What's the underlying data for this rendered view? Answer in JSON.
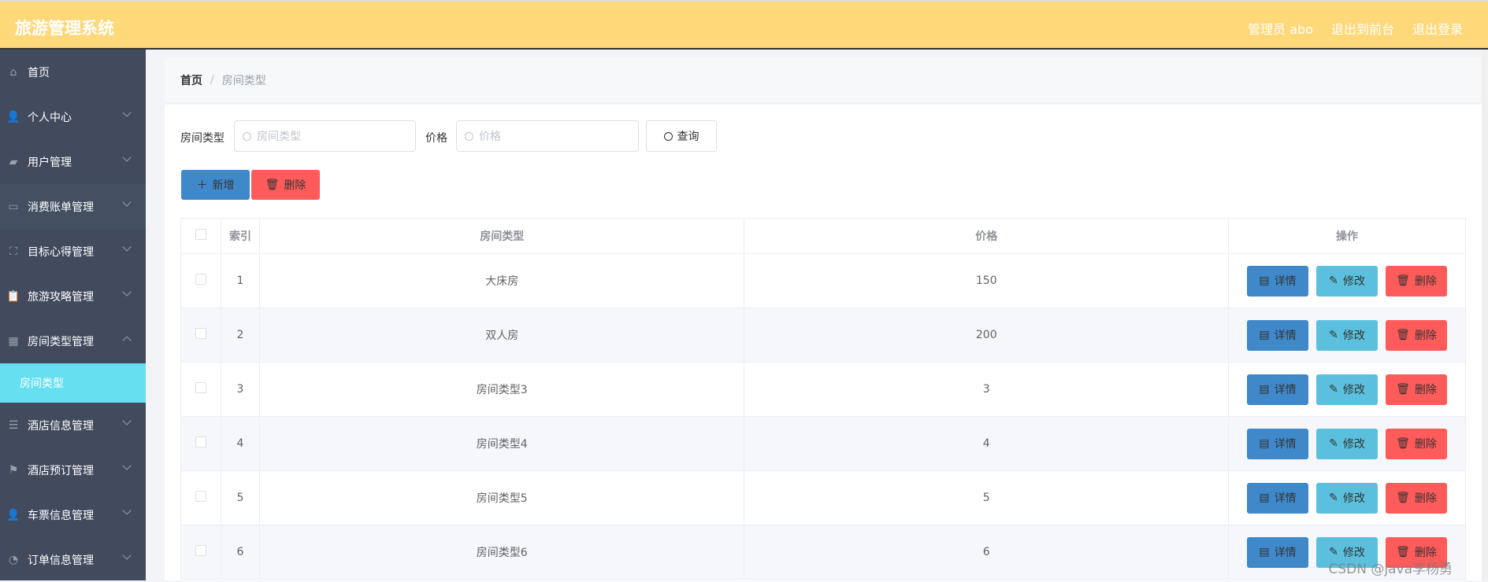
{
  "header": {
    "title": "旅游管理系统",
    "user": "管理员 abo",
    "to_front": "退出到前台",
    "logout": "退出登录"
  },
  "sidebar": {
    "items": [
      {
        "label": "首页",
        "icon": "home-icon"
      },
      {
        "label": "个人中心",
        "icon": "user-icon"
      },
      {
        "label": "用户管理",
        "icon": "wallet-icon"
      },
      {
        "label": "消费账单管理",
        "icon": "card-icon"
      },
      {
        "label": "目标心得管理",
        "icon": "frame-icon"
      },
      {
        "label": "旅游攻略管理",
        "icon": "clipboard-icon"
      },
      {
        "label": "房间类型管理",
        "icon": "grid-icon"
      },
      {
        "label": "酒店信息管理",
        "icon": "sliders-icon"
      },
      {
        "label": "酒店预订管理",
        "icon": "flag-icon"
      },
      {
        "label": "车票信息管理",
        "icon": "user-icon"
      },
      {
        "label": "订单信息管理",
        "icon": "gauge-icon"
      }
    ],
    "sub_active": "房间类型"
  },
  "breadcrumb": {
    "home": "首页",
    "current": "房间类型"
  },
  "search": {
    "type_label": "房间类型",
    "type_placeholder": "房间类型",
    "price_label": "价格",
    "price_placeholder": "价格",
    "query": "查询"
  },
  "toolbar": {
    "add": "新增",
    "delete": "删除"
  },
  "table": {
    "headers": [
      "索引",
      "房间类型",
      "价格",
      "操作"
    ],
    "rows": [
      {
        "index": "1",
        "type": "大床房",
        "price": "150"
      },
      {
        "index": "2",
        "type": "双人房",
        "price": "200"
      },
      {
        "index": "3",
        "type": "房间类型3",
        "price": "3"
      },
      {
        "index": "4",
        "type": "房间类型4",
        "price": "4"
      },
      {
        "index": "5",
        "type": "房间类型5",
        "price": "5"
      },
      {
        "index": "6",
        "type": "房间类型6",
        "price": "6"
      }
    ],
    "actions": {
      "detail": "详情",
      "edit": "修改",
      "delete": "删除"
    }
  },
  "watermark": "CSDN @java李杨勇",
  "colors": {
    "header": "#ffd87a",
    "sidebar": "#424a5d",
    "active": "#66e0f0",
    "primary": "#3f88c9",
    "info": "#5bc0de",
    "danger": "#ff5b5b"
  }
}
